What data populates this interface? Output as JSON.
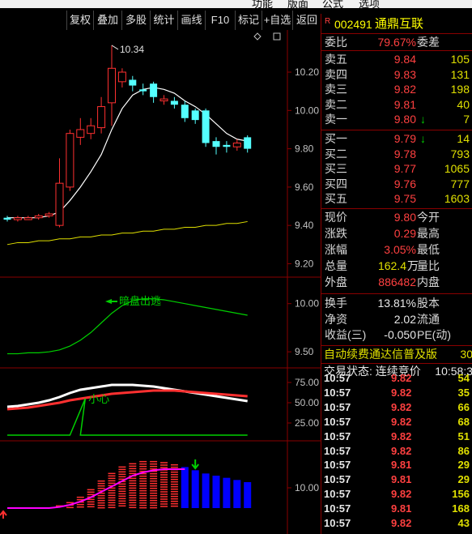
{
  "menubar": [
    "功能",
    "版面",
    "公式",
    "选项"
  ],
  "toolbar": [
    "复权",
    "叠加",
    "多股",
    "统计",
    "画线",
    "F10",
    "标记",
    "+自选",
    "返回"
  ],
  "stock": {
    "r_mark": "R",
    "code": "002491",
    "name": "通鼎互联"
  },
  "ratio": {
    "label": "委比",
    "value": "79.67%",
    "label2": "委差"
  },
  "asks": [
    {
      "label": "卖五",
      "price": "9.84",
      "vol": "105",
      "arrow": ""
    },
    {
      "label": "卖四",
      "price": "9.83",
      "vol": "131",
      "arrow": ""
    },
    {
      "label": "卖三",
      "price": "9.82",
      "vol": "198",
      "arrow": ""
    },
    {
      "label": "卖二",
      "price": "9.81",
      "vol": "40",
      "arrow": ""
    },
    {
      "label": "卖一",
      "price": "9.80",
      "vol": "7",
      "arrow": "↓"
    }
  ],
  "bids": [
    {
      "label": "买一",
      "price": "9.79",
      "vol": "14",
      "arrow": "↓"
    },
    {
      "label": "买二",
      "price": "9.78",
      "vol": "793",
      "arrow": ""
    },
    {
      "label": "买三",
      "price": "9.77",
      "vol": "1065",
      "arrow": ""
    },
    {
      "label": "买四",
      "price": "9.76",
      "vol": "777",
      "arrow": ""
    },
    {
      "label": "买五",
      "price": "9.75",
      "vol": "1603",
      "arrow": ""
    }
  ],
  "quote": [
    {
      "l1": "现价",
      "v1": "9.80",
      "l2": "今开",
      "c": "red"
    },
    {
      "l1": "涨跌",
      "v1": "0.29",
      "l2": "最高",
      "c": "red"
    },
    {
      "l1": "涨幅",
      "v1": "3.05%",
      "l2": "最低",
      "c": "red"
    },
    {
      "l1": "总量",
      "v1": "162.4",
      "unit": "万",
      "l2": "量比",
      "c": "yellow"
    },
    {
      "l1": "外盘",
      "v1": "886482",
      "l2": "内盘",
      "c": "red"
    }
  ],
  "fund": [
    {
      "l1": "换手",
      "v1": "13.81%",
      "l2": "股本"
    },
    {
      "l1": "净资",
      "v1": "2.02",
      "l2": "流通"
    },
    {
      "l1": "收益(三)",
      "v1": "-0.050",
      "l2": "PE(动)"
    }
  ],
  "marquee": {
    "text": "自动续费通达信普及版",
    "num": "30"
  },
  "trade_status": {
    "text": "交易状态: 连续竞价",
    "time": "10:58:3"
  },
  "ticks": [
    {
      "t": "10:57",
      "p": "9.82",
      "q": "54"
    },
    {
      "t": "10:57",
      "p": "9.82",
      "q": "35"
    },
    {
      "t": "10:57",
      "p": "9.82",
      "q": "66"
    },
    {
      "t": "10:57",
      "p": "9.82",
      "q": "68"
    },
    {
      "t": "10:57",
      "p": "9.82",
      "q": "51"
    },
    {
      "t": "10:57",
      "p": "9.82",
      "q": "86"
    },
    {
      "t": "10:57",
      "p": "9.81",
      "q": "29"
    },
    {
      "t": "10:57",
      "p": "9.81",
      "q": "29"
    },
    {
      "t": "10:57",
      "p": "9.82",
      "q": "156"
    },
    {
      "t": "10:57",
      "p": "9.81",
      "q": "168"
    },
    {
      "t": "10:57",
      "p": "9.82",
      "q": "43"
    }
  ],
  "chart_data": {
    "type": "candlestick",
    "main": {
      "high_label": "10.34",
      "y_ticks": [
        "10.20",
        "10.00",
        "9.80",
        "9.60",
        "9.40",
        "9.20"
      ],
      "ylim": [
        9.13,
        10.42
      ],
      "candles": [
        {
          "o": 9.44,
          "c": 9.43,
          "h": 9.45,
          "l": 9.42
        },
        {
          "o": 9.43,
          "c": 9.44,
          "h": 9.45,
          "l": 9.42
        },
        {
          "o": 9.43,
          "c": 9.44,
          "h": 9.45,
          "l": 9.43
        },
        {
          "o": 9.44,
          "c": 9.45,
          "h": 9.46,
          "l": 9.43
        },
        {
          "o": 9.45,
          "c": 9.46,
          "h": 9.47,
          "l": 9.44
        },
        {
          "o": 9.4,
          "c": 9.62,
          "h": 9.75,
          "l": 9.39
        },
        {
          "o": 9.6,
          "c": 9.88,
          "h": 9.9,
          "l": 9.58
        },
        {
          "o": 9.86,
          "c": 9.9,
          "h": 9.96,
          "l": 9.82
        },
        {
          "o": 9.88,
          "c": 9.92,
          "h": 9.96,
          "l": 9.85
        },
        {
          "o": 9.91,
          "c": 10.02,
          "h": 10.07,
          "l": 9.88
        },
        {
          "o": 10.04,
          "c": 10.22,
          "h": 10.34,
          "l": 9.92
        },
        {
          "o": 10.15,
          "c": 10.2,
          "h": 10.22,
          "l": 10.12
        },
        {
          "o": 10.16,
          "c": 10.13,
          "h": 10.18,
          "l": 10.1
        },
        {
          "o": 10.11,
          "c": 10.1,
          "h": 10.14,
          "l": 10.08
        },
        {
          "o": 10.14,
          "c": 10.07,
          "h": 10.15,
          "l": 10.04
        },
        {
          "o": 10.05,
          "c": 10.06,
          "h": 10.08,
          "l": 10.03
        },
        {
          "o": 10.05,
          "c": 10.03,
          "h": 10.07,
          "l": 10.01
        },
        {
          "o": 10.03,
          "c": 9.96,
          "h": 10.05,
          "l": 9.94
        },
        {
          "o": 10.0,
          "c": 9.95,
          "h": 10.01,
          "l": 9.93
        },
        {
          "o": 10.0,
          "c": 9.83,
          "h": 10.01,
          "l": 9.81
        },
        {
          "o": 9.84,
          "c": 9.81,
          "h": 9.86,
          "l": 9.77
        },
        {
          "o": 9.82,
          "c": 9.81,
          "h": 9.84,
          "l": 9.78
        },
        {
          "o": 9.81,
          "c": 9.83,
          "h": 9.85,
          "l": 9.79
        },
        {
          "o": 9.86,
          "c": 9.8,
          "h": 9.87,
          "l": 9.78
        }
      ],
      "ma": [
        9.44,
        9.44,
        9.44,
        9.44,
        9.45,
        9.47,
        9.53,
        9.6,
        9.68,
        9.77,
        9.9,
        10.01,
        10.08,
        10.11,
        10.12,
        10.11,
        10.09,
        10.05,
        10.02,
        9.98,
        9.93,
        9.88,
        9.85,
        9.84
      ],
      "long_ma": [
        9.3,
        9.31,
        9.31,
        9.32,
        9.32,
        9.33,
        9.33,
        9.34,
        9.34,
        9.35,
        9.35,
        9.36,
        9.36,
        9.37,
        9.37,
        9.38,
        9.38,
        9.39,
        9.39,
        9.4,
        9.4,
        9.41,
        9.41,
        9.42
      ]
    },
    "panel2": {
      "label": "暗盘出逃",
      "y_ticks": [
        "10.00",
        "9.50"
      ],
      "ylim": [
        9.35,
        10.25
      ],
      "line": [
        9.48,
        9.48,
        9.49,
        9.49,
        9.5,
        9.52,
        9.56,
        9.62,
        9.7,
        9.8,
        9.9,
        9.98,
        10.03,
        10.05,
        10.05,
        10.04,
        10.02,
        10.0,
        9.98,
        9.96,
        9.94,
        9.92,
        9.9,
        9.88
      ]
    },
    "panel3": {
      "label": "小心",
      "y_ticks": [
        "75.00",
        "50.00",
        "25.00"
      ],
      "ylim": [
        5,
        90
      ],
      "white": [
        45,
        46,
        48,
        50,
        53,
        57,
        62,
        66,
        68,
        70,
        72,
        72,
        72,
        71,
        70,
        68,
        66,
        64,
        62,
        60,
        58,
        56,
        54,
        52
      ],
      "red": [
        42,
        43,
        44,
        46,
        48,
        50,
        53,
        55,
        57,
        59,
        61,
        62,
        63,
        64,
        65,
        65,
        65,
        64,
        63,
        62,
        61,
        60,
        59,
        58
      ],
      "signal": [
        10,
        10,
        10,
        10,
        10,
        10,
        10,
        10,
        10,
        10,
        10,
        10,
        10,
        10,
        10,
        10,
        10,
        10,
        10,
        10,
        10,
        10,
        10,
        10
      ],
      "spike_index": 7
    },
    "panel4": {
      "y_ticks": [
        "10.00"
      ],
      "ylim": [
        9.0,
        11.0
      ],
      "bars": [
        0,
        0,
        0,
        0,
        0,
        2,
        5,
        10,
        17,
        25,
        32,
        38,
        41,
        43,
        43,
        42,
        40,
        38,
        35,
        32,
        30,
        28,
        26,
        24
      ],
      "bar_colors": [
        "r",
        "r",
        "r",
        "r",
        "r",
        "r",
        "r",
        "r",
        "r",
        "r",
        "r",
        "r",
        "r",
        "r",
        "r",
        "r",
        "r",
        "b",
        "b",
        "b",
        "b",
        "b",
        "b",
        "b"
      ],
      "purple": [
        0,
        0,
        0,
        0,
        0,
        1,
        3,
        6,
        10,
        15,
        20,
        25,
        30,
        33,
        35,
        36,
        36,
        36
      ],
      "max": 45
    },
    "colors": {
      "up": "#ff3030",
      "down": "#54ffff",
      "ma": "#ffffff",
      "long_ma": "#e0e000",
      "panel2": "#00d000",
      "blue": "#0000ff",
      "purple": "#ff00ff"
    }
  }
}
